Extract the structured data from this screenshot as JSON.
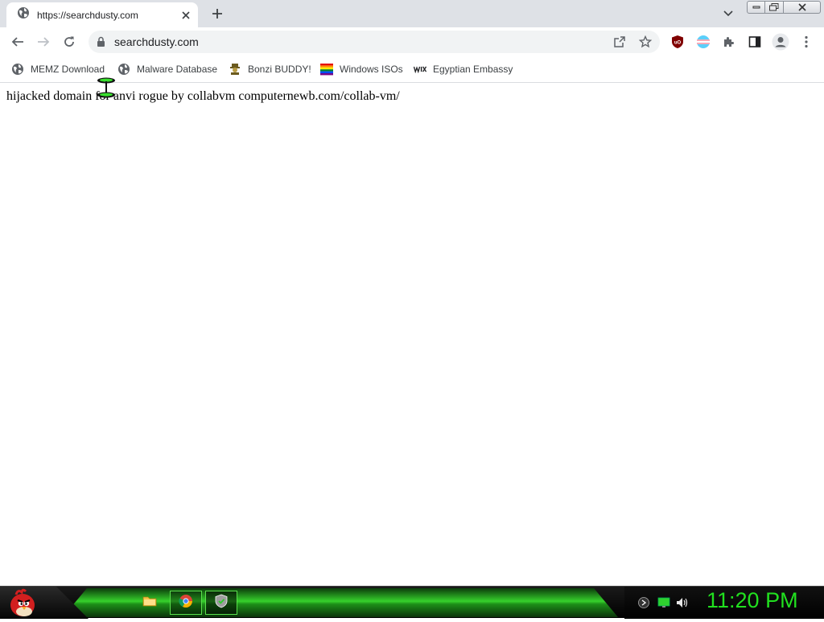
{
  "browser": {
    "tab": {
      "title": "https://searchdusty.com",
      "favicon": "globe-icon"
    },
    "new_tab_label": "+",
    "toolbar": {
      "url": "searchdusty.com"
    },
    "bookmarks": [
      {
        "label": "MEMZ Download",
        "icon": "globe-icon"
      },
      {
        "label": "Malware Database",
        "icon": "globe-icon"
      },
      {
        "label": "Bonzi BUDDY!",
        "icon": "bonzi-icon"
      },
      {
        "label": "Windows ISOs",
        "icon": "rainbow-flag-icon"
      },
      {
        "label": "Egyptian Embassy",
        "icon": "wix-icon"
      }
    ],
    "extensions": [
      "ublock-icon",
      "flag-extension-icon",
      "puzzle-icon",
      "side-panel-icon",
      "profile-icon",
      "menu-icon"
    ]
  },
  "page": {
    "text": "hijacked domain for anvi rogue by collabvm computernewb.com/collab-vm/"
  },
  "taskbar": {
    "clock": "11:20 PM",
    "apps": [
      "folder-icon",
      "chrome-icon",
      "security-shield-icon"
    ],
    "tray": [
      "keyboard-icon",
      "network-icon",
      "volume-icon"
    ]
  },
  "colors": {
    "tabstrip": "#dee1e6",
    "omnibox": "#f1f3f4",
    "taskbar_accent": "#36d12c",
    "clock": "#21e01f"
  }
}
